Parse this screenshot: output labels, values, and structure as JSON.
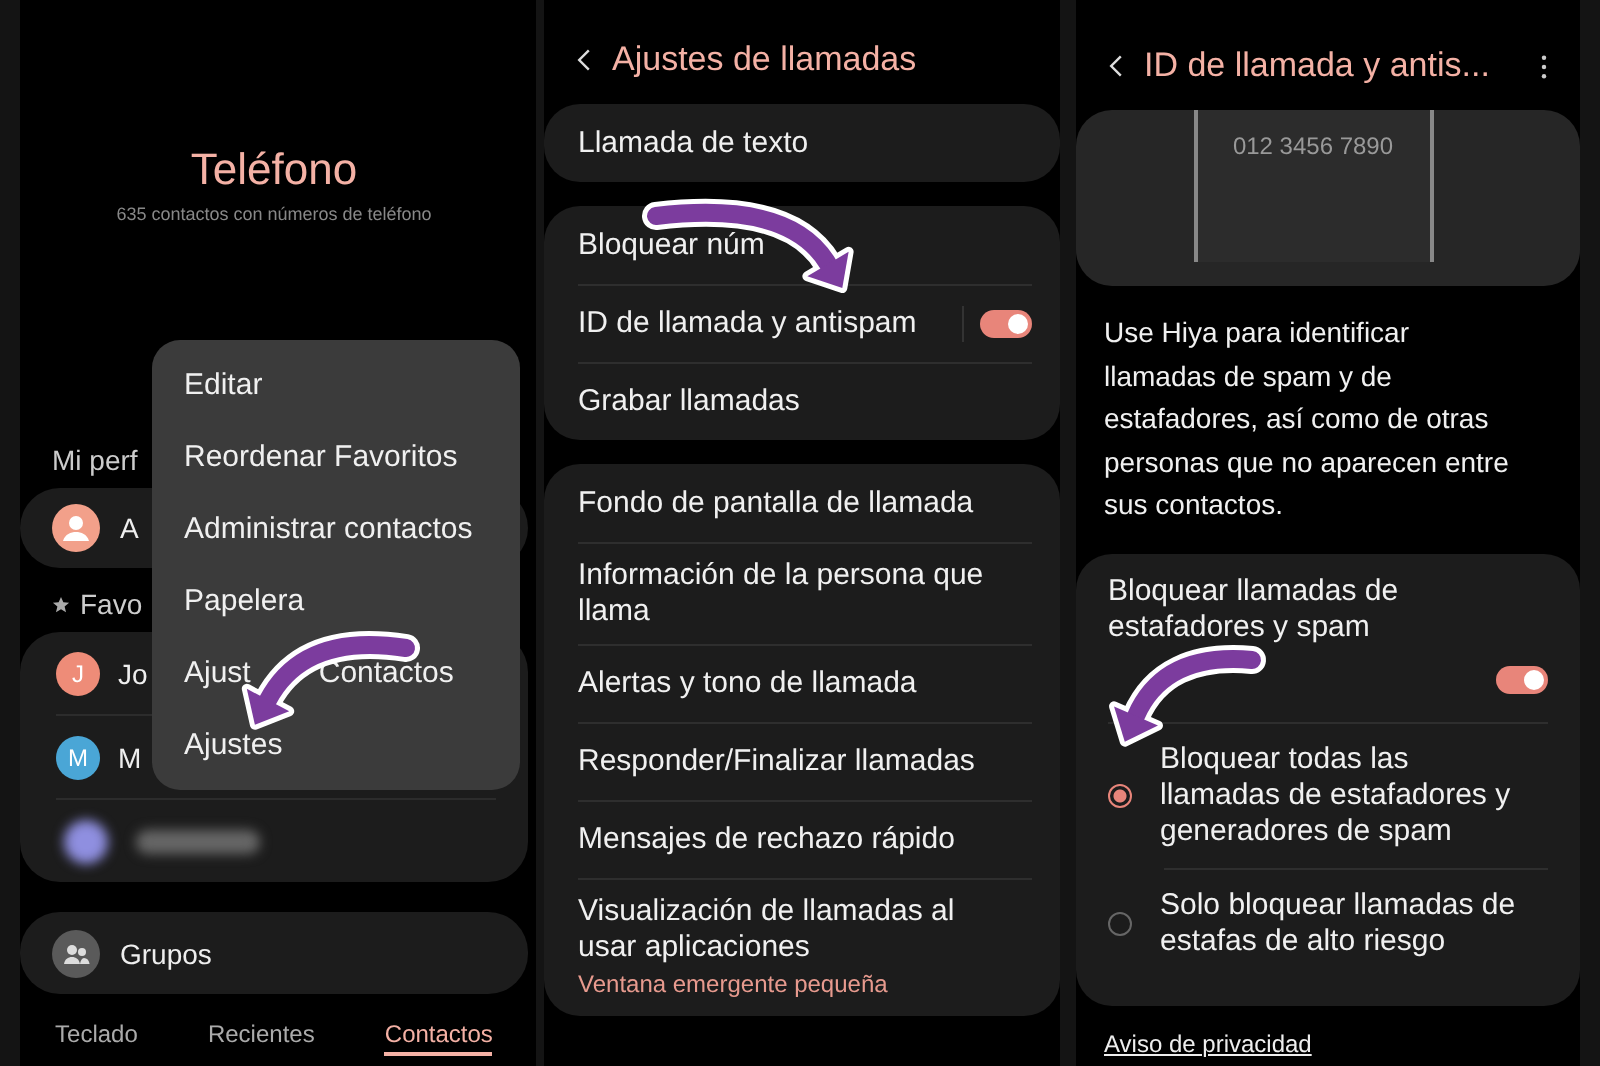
{
  "contacts_screen": {
    "title": "Teléfono",
    "subtitle": "635 contactos con números de teléfono",
    "profile_label": "Mi perf",
    "profile_name": "A",
    "favorites_label": "Favo",
    "favorites": [
      {
        "initial": "J",
        "name": "Jo",
        "color": "#ee8c78"
      },
      {
        "initial": "M",
        "name": "M",
        "color": "#4aa6d6"
      }
    ],
    "groups": "Grupos",
    "tabs": [
      {
        "label": "Teclado",
        "selected": false
      },
      {
        "label": "Recientes",
        "selected": false
      },
      {
        "label": "Contactos",
        "selected": true
      }
    ],
    "menu": [
      {
        "label": "Editar"
      },
      {
        "label": "Reordenar Favoritos"
      },
      {
        "label": "Administrar contactos"
      },
      {
        "label": "Papelera"
      },
      {
        "label_parts": [
          "Ajust",
          "Contactos"
        ]
      },
      {
        "label": "Ajustes"
      }
    ]
  },
  "call_settings_screen": {
    "title": "Ajustes de llamadas",
    "groups": [
      [
        {
          "kind": "plain",
          "label": "Llamada de texto"
        }
      ],
      [
        {
          "kind": "plain",
          "label": "Bloquear núm"
        },
        {
          "kind": "toggle",
          "label": "ID de llamada y antispam",
          "on": true
        },
        {
          "kind": "plain",
          "label": "Grabar llamadas"
        }
      ],
      [
        {
          "kind": "plain",
          "label": "Fondo de pantalla de llamada"
        },
        {
          "kind": "plain",
          "label": "Información de la persona que llama"
        },
        {
          "kind": "plain",
          "label": "Alertas y tono de llamada"
        },
        {
          "kind": "plain",
          "label": "Responder/Finalizar llamadas"
        },
        {
          "kind": "plain",
          "label": "Mensajes de rechazo rápido"
        },
        {
          "kind": "plain",
          "label": "Visualización de llamadas al usar aplicaciones",
          "summary": "Ventana emergente pequeña"
        }
      ]
    ]
  },
  "caller_id_screen": {
    "title": "ID de llamada y antis...",
    "illustration_number": "012 3456 7890",
    "description": "Use Hiya para identificar llamadas de spam y de estafadores, así como de otras personas que no aparecen entre sus contactos.",
    "block_setting": {
      "label": "Bloquear llamadas de estafadores y spam",
      "on": true,
      "options": [
        {
          "label": "Bloquear todas las llamadas de estafadores y generadores de spam",
          "selected": true
        },
        {
          "label": "Solo bloquear llamadas de estafas de alto riesgo",
          "selected": false
        }
      ]
    },
    "privacy_link": "Aviso de privacidad"
  }
}
